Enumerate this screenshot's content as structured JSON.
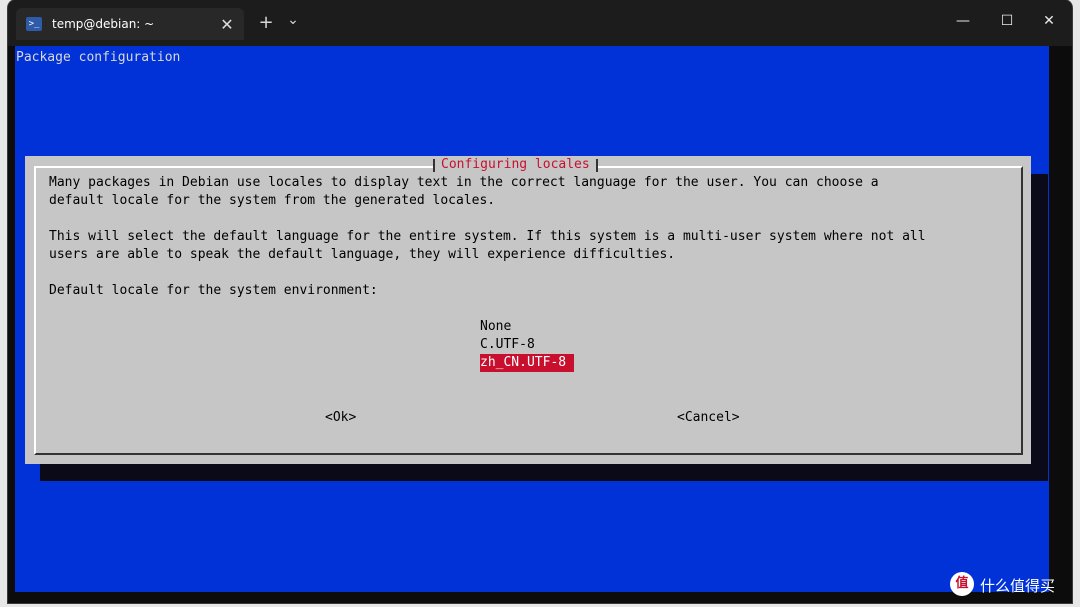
{
  "window": {
    "tab_title": "temp@debian: ~",
    "tab_icon": "powershell-icon",
    "new_tab_symbol": "+",
    "dropdown_symbol": "⌄",
    "close_tab_symbol": "✕",
    "minimize_symbol": "—",
    "maximize_symbol": "☐",
    "close_symbol": "✕"
  },
  "terminal": {
    "background_color": "#0032d8",
    "package_title": "Package configuration",
    "dialog": {
      "title": "Configuring locales",
      "paragraph1_line1": "Many packages in Debian use locales to display text in the correct language for the user. You can choose a",
      "paragraph1_line2": "default locale for the system from the generated locales.",
      "paragraph2_line1": "This will select the default language for the entire system. If this system is a multi-user system where not all",
      "paragraph2_line2": "users are able to speak the default language, they will experience difficulties.",
      "prompt": "Default locale for the system environment:",
      "options": [
        "None",
        "C.UTF-8",
        "zh_CN.UTF-8"
      ],
      "selected_option": "zh_CN.UTF-8",
      "ok_button": "<Ok>",
      "cancel_button": "<Cancel>",
      "highlight_color": "#c8102e"
    }
  },
  "watermark": {
    "logo_glyph": "值",
    "text": "什么值得买"
  }
}
